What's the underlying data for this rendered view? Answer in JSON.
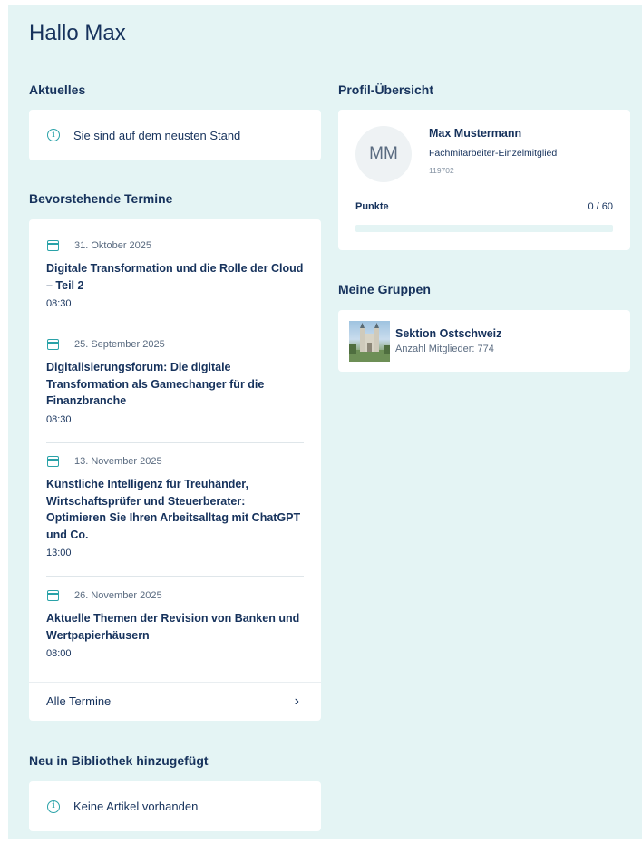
{
  "greeting": "Hallo Max",
  "aktuelles": {
    "heading": "Aktuelles",
    "message": "Sie sind auf dem neusten Stand"
  },
  "termine": {
    "heading": "Bevorstehende Termine",
    "events": [
      {
        "date": "31. Oktober 2025",
        "title": "Digitale Transformation und die Rolle der Cloud – Teil 2",
        "time": "08:30"
      },
      {
        "date": "25. September 2025",
        "title": "Digitalisierungsforum: Die digitale Transformation als Gamechanger für die Finanzbranche",
        "time": "08:30"
      },
      {
        "date": "13. November 2025",
        "title": "Künstliche Intelligenz für Treuhänder, Wirtschaftsprüfer und Steuerberater: Optimieren Sie Ihren Arbeitsalltag mit ChatGPT und Co.",
        "time": "13:00"
      },
      {
        "date": "26. November 2025",
        "title": "Aktuelle Themen der Revision von Banken und Wertpapierhäusern",
        "time": "08:00"
      }
    ],
    "all_label": "Alle Termine"
  },
  "bibliothek": {
    "heading": "Neu in Bibliothek hinzugefügt",
    "message": "Keine Artikel vorhanden"
  },
  "profil": {
    "heading": "Profil-Übersicht",
    "initials": "MM",
    "name": "Max Mustermann",
    "role": "Fachmitarbeiter-Einzelmitglied",
    "member_id": "119702",
    "points_label": "Punkte",
    "points_value": "0 / 60",
    "points_fraction": 0
  },
  "gruppen": {
    "heading": "Meine Gruppen",
    "items": [
      {
        "name": "Sektion Ostschweiz",
        "members": "Anzahl Mitglieder: 774"
      }
    ]
  },
  "colors": {
    "background": "#e4f4f4",
    "text": "#16325c",
    "accent": "#2aa2a8",
    "card": "#ffffff"
  },
  "icons": {
    "info": "info-circle-icon",
    "calendar": "calendar-icon",
    "chevron": "chevron-right-icon"
  }
}
